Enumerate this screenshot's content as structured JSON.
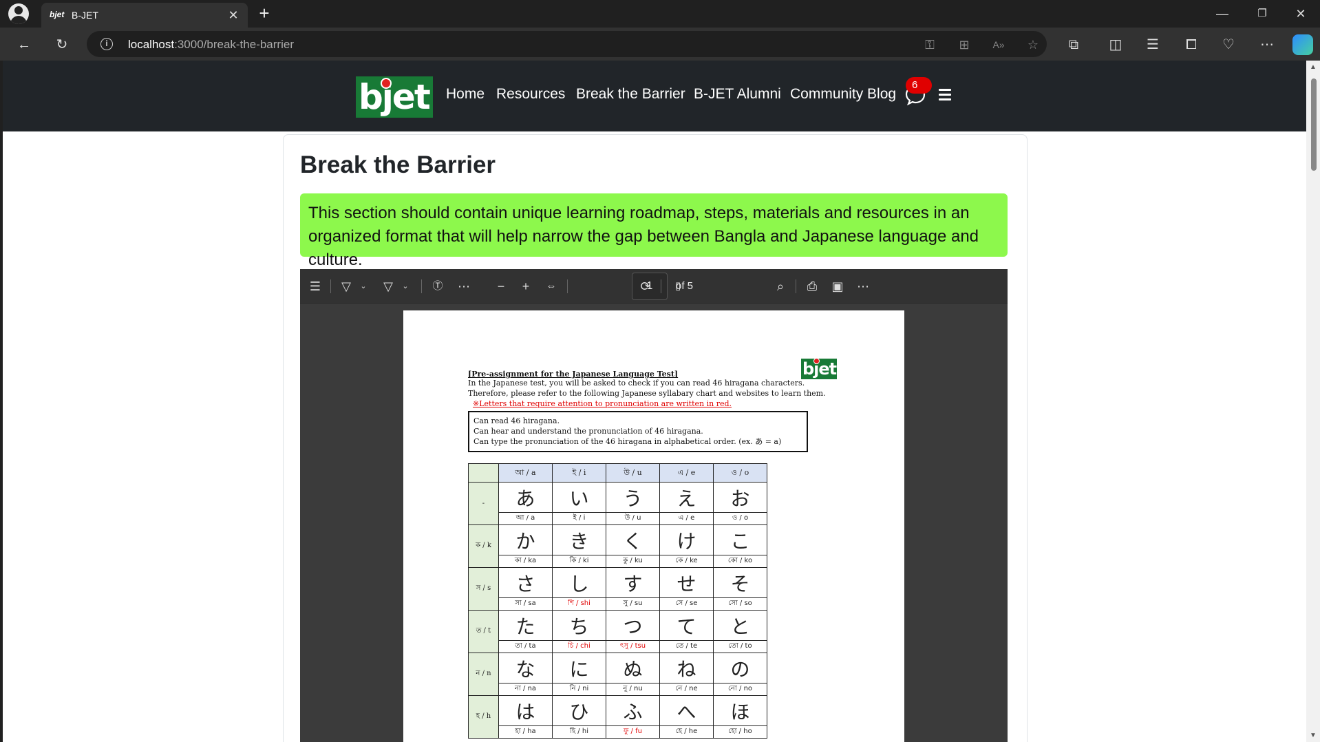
{
  "browser": {
    "tab_title": "B-JET",
    "tab_favicon_text": "bjet",
    "url_host": "localhost",
    "url_path": ":3000/break-the-barrier"
  },
  "site": {
    "logo_text": "bjet",
    "nav": [
      "Home",
      "Resources",
      "Break the Barrier",
      "B-JET Alumni",
      "Community Blog"
    ],
    "chat_badge": "6"
  },
  "page": {
    "title": "Break the Barrier",
    "intro": "This section should contain unique learning roadmap, steps, materials and resources in an organized format that will help narrow the gap between Bangla and Japanese language and culture."
  },
  "pdf": {
    "current_page": "1",
    "page_of": "of 5",
    "doc_logo": "bjet",
    "heading": "[Pre-assignment for the Japanese Language Test]",
    "line1": "In the Japanese test, you will be asked to check if you can read 46 hiragana characters.",
    "line2": "Therefore, please refer to the following Japanese syllabary chart and websites to learn them.",
    "red_note": "※Letters that require   attention to pronunciation are written in red.",
    "box_lines": [
      "Can read 46 hiragana.",
      "Can hear and understand the pronunciation of 46 hiragana.",
      "Can type the pronunciation of the 46 hiragana in alphabetical order. (ex. あ = a)"
    ],
    "column_headers": [
      "আ / a",
      "ই / i",
      "উ / u",
      "এ / e",
      "ও / o"
    ],
    "rows": [
      {
        "label": "-",
        "kana": [
          "あ",
          "い",
          "う",
          "え",
          "お"
        ],
        "roma": [
          "আ / a",
          "ই / i",
          "উ / u",
          "এ / e",
          "ও / o"
        ],
        "red": []
      },
      {
        "label": "ক / k",
        "kana": [
          "か",
          "き",
          "く",
          "け",
          "こ"
        ],
        "roma": [
          "কা / ka",
          "কি / ki",
          "কু / ku",
          "কে / ke",
          "কো / ko"
        ],
        "red": []
      },
      {
        "label": "স / s",
        "kana": [
          "さ",
          "し",
          "す",
          "せ",
          "そ"
        ],
        "roma": [
          "সা / sa",
          "শি / shi",
          "সু / su",
          "সে / se",
          "সো / so"
        ],
        "red": [
          1
        ]
      },
      {
        "label": "ত / t",
        "kana": [
          "た",
          "ち",
          "つ",
          "て",
          "と"
        ],
        "roma": [
          "তা / ta",
          "চি / chi",
          "ৎসু / tsu",
          "তে / te",
          "তো / to"
        ],
        "red": [
          1,
          2
        ]
      },
      {
        "label": "ন / n",
        "kana": [
          "な",
          "に",
          "ぬ",
          "ね",
          "の"
        ],
        "roma": [
          "না / na",
          "নি / ni",
          "নু / nu",
          "নে / ne",
          "নো / no"
        ],
        "red": []
      },
      {
        "label": "হ / h",
        "kana": [
          "は",
          "ひ",
          "ふ",
          "へ",
          "ほ"
        ],
        "roma": [
          "হা / ha",
          "হি / hi",
          "ফু / fu",
          "হে / he",
          "হো / ho"
        ],
        "red": [
          2
        ]
      }
    ]
  }
}
